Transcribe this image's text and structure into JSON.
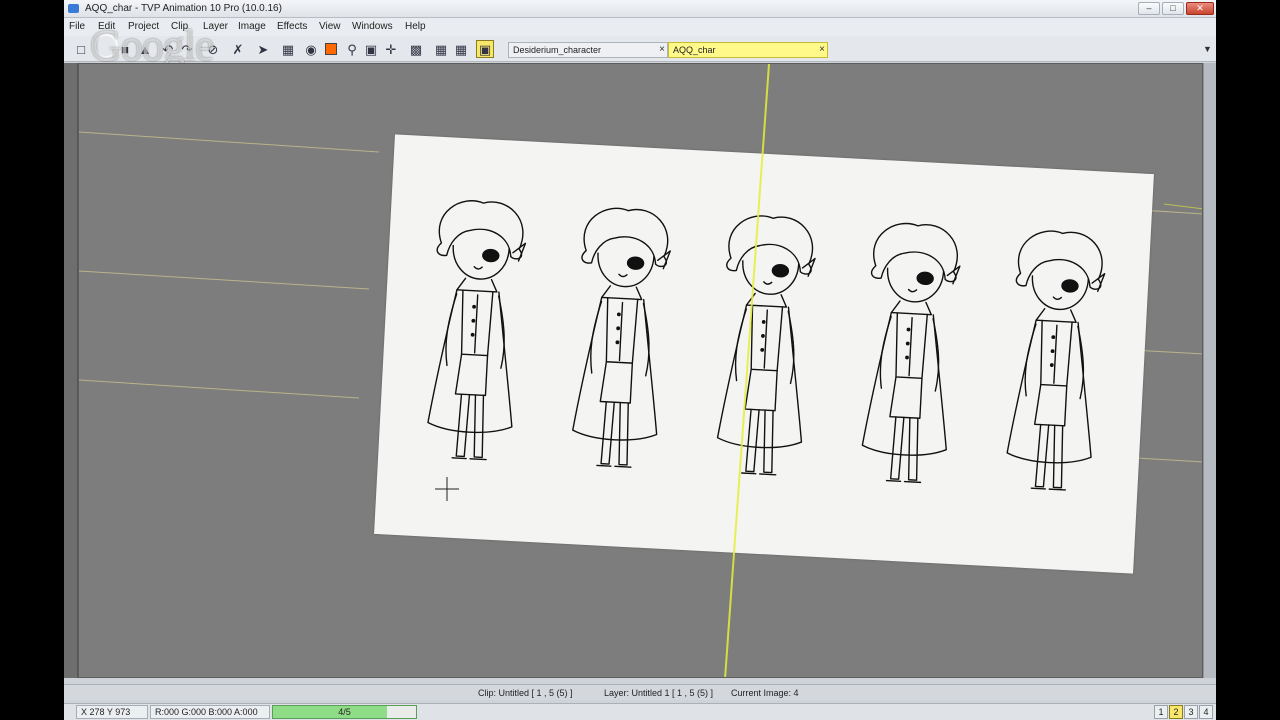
{
  "window": {
    "title": "AQQ_char - TVP Animation 10 Pro (10.0.16)"
  },
  "menu": [
    "File",
    "Edit",
    "Project",
    "Clip",
    "Layer",
    "Image",
    "Effects",
    "View",
    "Windows",
    "Help"
  ],
  "overlay": {
    "watermark": "Google"
  },
  "tabs": [
    {
      "label": "Desiderium_character",
      "close": "×",
      "active": false
    },
    {
      "label": "AQQ_char",
      "close": "×",
      "active": true
    }
  ],
  "tab_menu_glyph": "▼",
  "status": {
    "clip": "Clip: Untitled [ 1 , 5  (5) ]",
    "layer": "Layer: Untitled 1 [ 1 , 5  (5) ]",
    "current_image": "Current Image: 4"
  },
  "bottom": {
    "coords": "X 278  Y 973",
    "color": "R:000 G:000 B:000 A:000",
    "frame_label": "4/5",
    "frame_fraction": 0.8,
    "pages": [
      "1",
      "2",
      "3",
      "4"
    ],
    "active_page": "2"
  },
  "colors": {
    "accent_yellow": "#f8e76a",
    "progress_green": "#8fdc86",
    "canvas_bg": "#7d7d7d",
    "paper": "#f4f4f2",
    "guide": "#e6ee3a"
  }
}
